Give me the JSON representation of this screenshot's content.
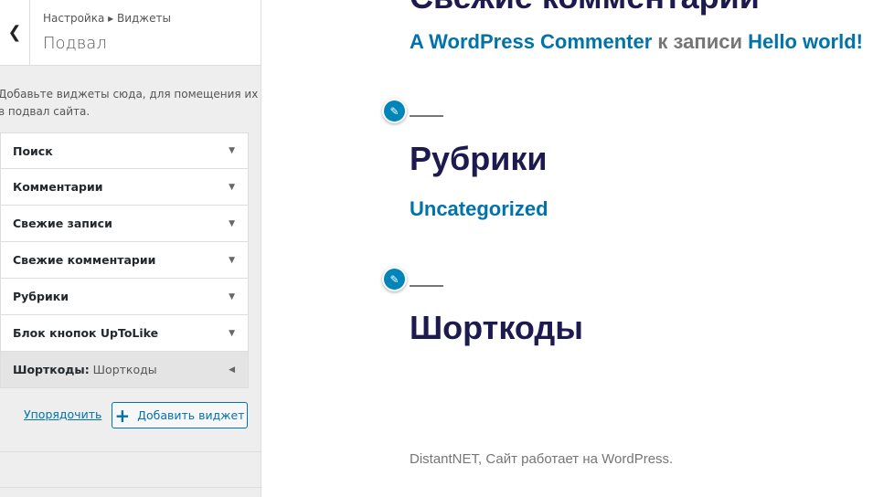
{
  "sidebar": {
    "breadcrumb": "Настройка ▸ Виджеты",
    "title": "Подвал",
    "description": "Добавьте виджеты сюда, для помещения их в подвал сайта.",
    "widgets": [
      {
        "label": "Поиск",
        "sub": ""
      },
      {
        "label": "Комментарии",
        "sub": ""
      },
      {
        "label": "Свежие записи",
        "sub": ""
      },
      {
        "label": "Свежие комментарии",
        "sub": ""
      },
      {
        "label": "Рубрики",
        "sub": ""
      },
      {
        "label": "Блок кнопок UpToLike",
        "sub": ""
      },
      {
        "label": "Шорткоды:",
        "sub": " Шорткоды"
      }
    ],
    "reorder": "Упорядочить",
    "add_widget": "Добавить виджет"
  },
  "preview": {
    "recent_comments_title": "Свежие комментарии",
    "comment": {
      "author": "A WordPress Commenter",
      "middle": " к записи ",
      "post": "Hello world!"
    },
    "categories_title": "Рубрики",
    "category": "Uncategorized",
    "shortcodes_title": "Шорткоды",
    "footer": "DistantNET, Сайт работает на WordPress."
  },
  "colors": {
    "accent": "#0073aa",
    "heading": "#1c1a4f",
    "edit": "#0085ba"
  }
}
